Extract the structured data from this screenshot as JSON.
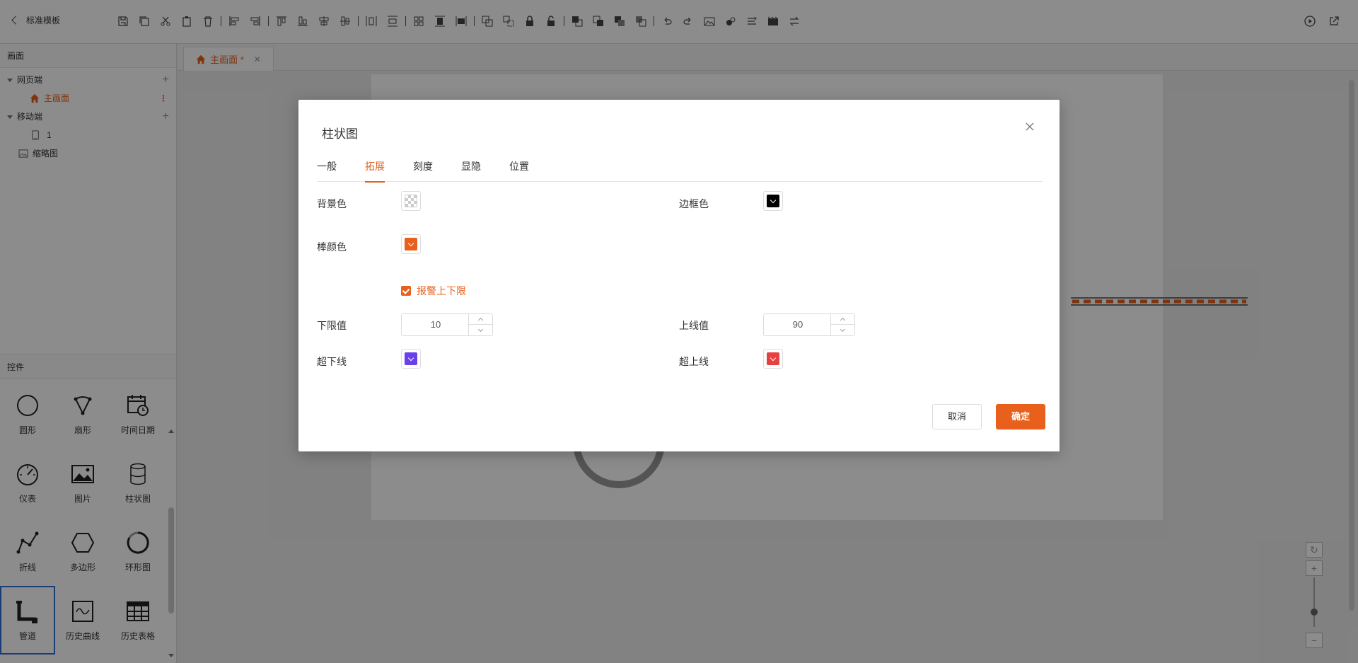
{
  "topbar": {
    "back_label": "标准模板",
    "tools": [
      "save-icon",
      "copy-icon",
      "cut-icon",
      "paste-icon",
      "delete-icon",
      "|",
      "align-left-icon",
      "align-right-icon",
      "|",
      "align-top-icon",
      "align-bottom-icon",
      "align-center-h-icon",
      "align-center-v-icon",
      "|",
      "distribute-h-icon",
      "distribute-v-icon",
      "|",
      "grid-icon",
      "same-height-icon",
      "same-width-icon",
      "|",
      "group-icon",
      "ungroup-icon",
      "lock-icon",
      "unlock-icon",
      "|",
      "bring-front-icon",
      "send-back-icon",
      "bring-forward-icon",
      "send-backward-icon",
      "|",
      "undo-icon",
      "redo-icon",
      "image-icon",
      "layers-icon",
      "import-icon",
      "film-icon",
      "swap-icon"
    ],
    "right_tools": [
      "play-icon",
      "export-icon"
    ]
  },
  "left_panel": {
    "screens_title": "画面",
    "web_label": "网页端",
    "main_screen": "主画面",
    "mobile_label": "移动端",
    "mobile_item": "1",
    "thumbnail_label": "缩略图",
    "controls_title": "控件",
    "controls": [
      {
        "label": "圆形",
        "icon": "circle-icon"
      },
      {
        "label": "扇形",
        "icon": "sector-icon"
      },
      {
        "label": "时间日期",
        "icon": "calendar-clock-icon"
      },
      {
        "label": "仪表",
        "icon": "gauge-icon"
      },
      {
        "label": "图片",
        "icon": "image-icon"
      },
      {
        "label": "柱状图",
        "icon": "cylinder-icon"
      },
      {
        "label": "折线",
        "icon": "polyline-icon"
      },
      {
        "label": "多边形",
        "icon": "hexagon-icon"
      },
      {
        "label": "环形图",
        "icon": "ring-icon"
      },
      {
        "label": "管道",
        "icon": "pipe-icon"
      },
      {
        "label": "历史曲线",
        "icon": "history-curve-icon"
      },
      {
        "label": "历史表格",
        "icon": "history-table-icon"
      }
    ]
  },
  "editor": {
    "tab_label": "主画面 *"
  },
  "dialog": {
    "title": "柱状图",
    "tabs": [
      "一般",
      "拓展",
      "刻度",
      "显隐",
      "位置"
    ],
    "active_tab": "拓展",
    "fields": {
      "bg_color_label": "背景色",
      "bg_color": "transparent",
      "border_color_label": "边框色",
      "border_color": "#000000",
      "bar_color_label": "棒颜色",
      "bar_color": "#e8601c",
      "alarm_label": "报警上下限",
      "alarm_checked": true,
      "lower_label": "下限值",
      "lower_value": "10",
      "upper_label": "上线值",
      "upper_value": "90",
      "below_color_label": "超下线",
      "below_color": "#6a40e8",
      "above_color_label": "超上线",
      "above_color": "#e84040"
    },
    "cancel_label": "取消",
    "ok_label": "确定"
  },
  "colors": {
    "accent": "#e8601c",
    "selection_border": "#2f6fd6"
  }
}
